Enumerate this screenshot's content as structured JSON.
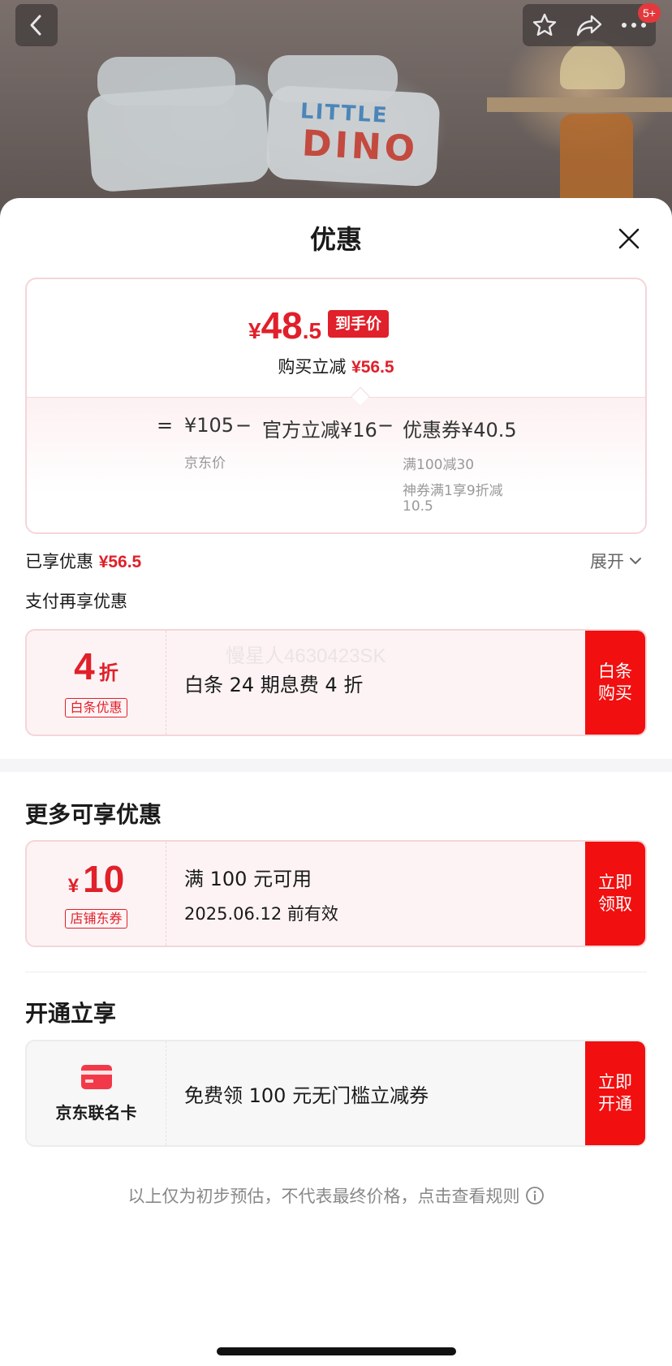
{
  "photo": {
    "pillow_text_line1": "LITTLE",
    "pillow_text_line2": "DINO"
  },
  "top_bar": {
    "badge": "5+"
  },
  "sheet": {
    "title": "优惠"
  },
  "price": {
    "currency": "¥",
    "final_int": "48",
    "final_dec": ".5",
    "final_tag": "到手价",
    "save_label": "购买立减",
    "save_value": "¥56.5",
    "eq": "=",
    "jd_price": "¥105",
    "minus1": "−",
    "official_off": "官方立减¥16",
    "minus2": "−",
    "coupon_off": "优惠券¥40.5",
    "jd_price_label": "京东价",
    "coupon_detail_1": "满100减30",
    "coupon_detail_2": "神券满1享9折减",
    "coupon_detail_3": "10.5"
  },
  "enjoyed": {
    "label": "已享优惠",
    "value": "¥56.5",
    "expand": "展开"
  },
  "pay_more": {
    "title": "支付再享优惠",
    "watermark": "慢星人4630423SK",
    "coupon": {
      "big_num": "4",
      "big_unit": "折",
      "tag": "白条优惠",
      "desc": "白条 24 期息费 4 折",
      "action": "白条\n购买"
    }
  },
  "more": {
    "title": "更多可享优惠",
    "coupon": {
      "currency": "¥",
      "amount": "10",
      "tag": "店铺东券",
      "desc_line1": "满 100 元可用",
      "desc_line2": "2025.06.12 前有效",
      "action": "立即\n领取"
    }
  },
  "open": {
    "title": "开通立享",
    "card": {
      "name": "京东联名卡",
      "desc": "免费领 100 元无门槛立减券",
      "action": "立即\n开通"
    }
  },
  "footnote": "以上仅为初步预估，不代表最终价格，点击查看规则",
  "colors": {
    "accent_red": "#e0202a",
    "action_red": "#f20f0f"
  },
  "icons": {
    "back": "chevron-left-icon",
    "favorite": "star-icon",
    "share": "share-icon",
    "more": "more-dots-icon",
    "close": "close-icon",
    "expand": "chevron-down-icon",
    "card": "credit-card-icon",
    "info": "info-icon"
  }
}
